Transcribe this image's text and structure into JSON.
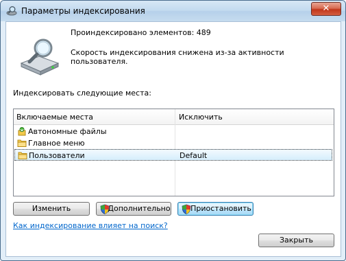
{
  "window": {
    "title": "Параметры индексирования",
    "close_label": "✕"
  },
  "stats": {
    "indexed_count": "Проиндексировано элементов: 489",
    "status": "Скорость индексирования снижена из-за активности пользователя."
  },
  "places_label": "Индексировать следующие места:",
  "table": {
    "columns": [
      "Включаемые места",
      "Исключить"
    ],
    "rows": [
      {
        "name": "Автономные файлы",
        "exclude": "",
        "icon": "offline-files-icon"
      },
      {
        "name": "Главное меню",
        "exclude": "",
        "icon": "folder-icon"
      },
      {
        "name": "Пользователи",
        "exclude": "Default",
        "icon": "folder-icon",
        "selected": true
      }
    ]
  },
  "buttons": {
    "modify": "Изменить",
    "advanced": "Дополнительно",
    "pause": "Приостановить",
    "close": "Закрыть"
  },
  "help_link": "Как индексирование влияет на поиск?"
}
